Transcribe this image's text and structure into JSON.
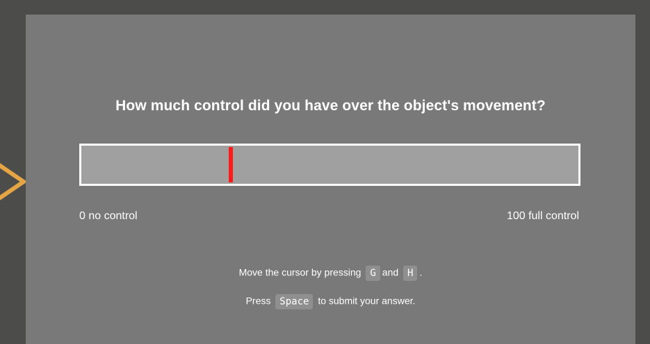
{
  "prompt": {
    "question": "How much control did you have over the object's movement?"
  },
  "rating_scale": {
    "min_label": "0 no control",
    "max_label": "100 full control",
    "min": 0,
    "max": 100,
    "current_value": 30
  },
  "instructions": {
    "move_prefix": "Move the cursor by pressing",
    "move_key_1": "G",
    "move_and": "and",
    "move_key_2": "H",
    "move_suffix": ".",
    "submit_prefix": "Press",
    "submit_key": "Space",
    "submit_suffix": "to submit your answer."
  },
  "colors": {
    "background": "#4c4c4a",
    "panel": "#797979",
    "slider_track": "#a0a0a0",
    "slider_border": "#ffffff",
    "marker": "#ff1a1a",
    "chevron": "#e6a545"
  },
  "icons": {
    "back": "chevron-left-icon"
  }
}
